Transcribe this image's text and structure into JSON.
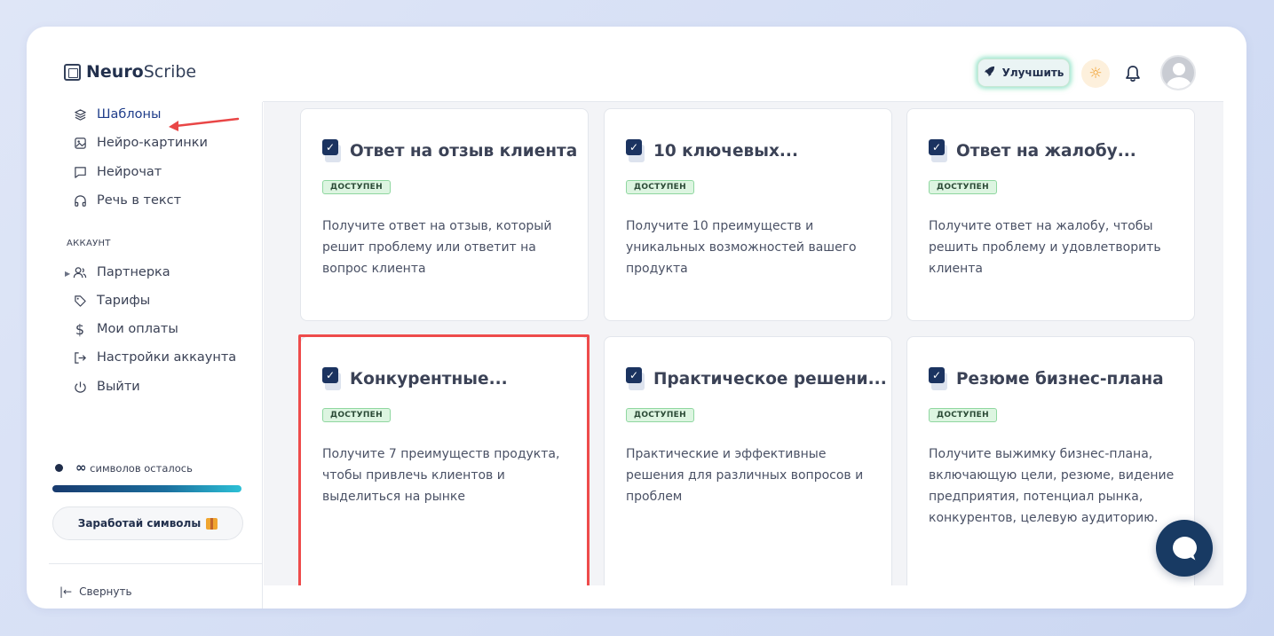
{
  "app": {
    "logo_bold": "Neuro",
    "logo_rest": "Scribe"
  },
  "header": {
    "upgrade_label": "Улучшить"
  },
  "sidebar": {
    "items": [
      {
        "label": "Шаблоны",
        "icon": "layers-icon"
      },
      {
        "label": "Нейро-картинки",
        "icon": "image-icon"
      },
      {
        "label": "Нейрочат",
        "icon": "chat-icon"
      },
      {
        "label": "Речь в текст",
        "icon": "headphones-icon"
      }
    ],
    "section_label": "АККАУНТ",
    "account_items": [
      {
        "label": "Партнерка",
        "icon": "users-icon"
      },
      {
        "label": "Тарифы",
        "icon": "tag-icon"
      },
      {
        "label": "Мои оплаты",
        "icon": "dollar-icon"
      },
      {
        "label": "Настройки аккаунта",
        "icon": "login-icon"
      },
      {
        "label": "Выйти",
        "icon": "power-icon"
      }
    ],
    "credits_symbol": "∞",
    "credits_text": "символов осталось",
    "earn_label": "Заработай символы",
    "collapse_label": "Свернуть"
  },
  "cards": [
    {
      "title": "Ответ на отзыв клиента",
      "badge": "ДОСТУПЕН",
      "desc": "Получите ответ на отзыв, который решит проблему или ответит на вопрос клиента"
    },
    {
      "title": "10 ключевых...",
      "badge": "ДОСТУПЕН",
      "desc": "Получите 10 преимуществ и уникальных возможностей вашего продукта"
    },
    {
      "title": "Ответ на жалобу...",
      "badge": "ДОСТУПЕН",
      "desc": "Получите ответ на жалобу, чтобы решить проблему и удовлетворить клиента"
    },
    {
      "title": "Конкурентные...",
      "badge": "ДОСТУПЕН",
      "desc": "Получите 7 преимуществ продукта, чтобы привлечь клиентов и выделиться на рынке"
    },
    {
      "title": "Практическое решени...",
      "badge": "ДОСТУПЕН",
      "desc": "Практические и эффективные решения для различных вопросов и проблем"
    },
    {
      "title": "Резюме бизнес-плана",
      "badge": "ДОСТУПЕН",
      "desc": "Получите выжимку бизнес-плана, включающую цели, резюме, видение предприятия, потенциал рынка, конкурентов, целевую аудиторию."
    }
  ],
  "colors": {
    "accent": "#1b3360",
    "highlight": "#ee4b4b",
    "badge_bg": "#ddf5e1",
    "annotation_arrow": "#e94646"
  }
}
